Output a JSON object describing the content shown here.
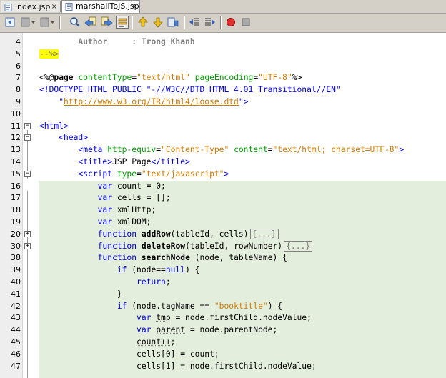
{
  "tabs": [
    {
      "label": "index.jsp",
      "close": "×",
      "active": false
    },
    {
      "label": "marshallToJS.jsp",
      "close": "×",
      "active": true
    }
  ],
  "toolbar": {
    "buttons": [
      "back-icon",
      "forward-dropdown-icon",
      "history-dropdown-icon",
      "find-icon",
      "find-previous-icon",
      "find-next-icon",
      "toggle-highlight-icon",
      "previous-bookmark-icon",
      "next-bookmark-icon",
      "toggle-bookmark-icon",
      "shift-left-icon",
      "shift-right-icon",
      "start-macro-icon",
      "stop-macro-icon"
    ]
  },
  "editor": {
    "lines": [
      {
        "n": "4",
        "segs": [
          {
            "t": "        Author     : Trong Khanh",
            "c": "cmt-bold"
          }
        ]
      },
      {
        "n": "5",
        "segs": [
          {
            "t": "--%>",
            "c": "yel"
          }
        ]
      },
      {
        "n": "6",
        "segs": [
          {
            "t": "",
            "c": "black"
          }
        ]
      },
      {
        "n": "7",
        "segs": [
          {
            "t": "<%@",
            "c": "black"
          },
          {
            "t": "page",
            "c": "bold"
          },
          {
            "t": " ",
            "c": "black"
          },
          {
            "t": "contentType",
            "c": "attr"
          },
          {
            "t": "=",
            "c": "black"
          },
          {
            "t": "\"text/html\"",
            "c": "str"
          },
          {
            "t": " ",
            "c": "black"
          },
          {
            "t": "pageEncoding",
            "c": "attr"
          },
          {
            "t": "=",
            "c": "black"
          },
          {
            "t": "\"UTF-8\"",
            "c": "str"
          },
          {
            "t": "%>",
            "c": "black"
          }
        ]
      },
      {
        "n": "8",
        "segs": [
          {
            "t": "<!DOCTYPE HTML PUBLIC \"-//W3C//DTD HTML 4.01 Transitional//EN\"",
            "c": "tag"
          }
        ]
      },
      {
        "n": "9",
        "segs": [
          {
            "t": "    \"",
            "c": "tag"
          },
          {
            "t": "http://www.w3.org/TR/html4/loose.dtd",
            "c": "url"
          },
          {
            "t": "\">",
            "c": "tag"
          }
        ]
      },
      {
        "n": "10",
        "segs": [
          {
            "t": "",
            "c": "black"
          }
        ]
      },
      {
        "n": "11",
        "segs": [
          {
            "t": "<html>",
            "c": "tag"
          }
        ]
      },
      {
        "n": "12",
        "segs": [
          {
            "t": "    <head>",
            "c": "tag"
          }
        ]
      },
      {
        "n": "13",
        "segs": [
          {
            "t": "        <meta ",
            "c": "tag"
          },
          {
            "t": "http-equiv",
            "c": "attr"
          },
          {
            "t": "=",
            "c": "black"
          },
          {
            "t": "\"Content-Type\"",
            "c": "str"
          },
          {
            "t": " ",
            "c": "black"
          },
          {
            "t": "content",
            "c": "attr"
          },
          {
            "t": "=",
            "c": "black"
          },
          {
            "t": "\"text/html; charset=UTF-8\"",
            "c": "str"
          },
          {
            "t": ">",
            "c": "tag"
          }
        ]
      },
      {
        "n": "14",
        "segs": [
          {
            "t": "        <title>",
            "c": "tag"
          },
          {
            "t": "JSP Page",
            "c": "black"
          },
          {
            "t": "</title>",
            "c": "tag"
          }
        ]
      },
      {
        "n": "15",
        "segs": [
          {
            "t": "        <script ",
            "c": "tag"
          },
          {
            "t": "type",
            "c": "attr"
          },
          {
            "t": "=",
            "c": "black"
          },
          {
            "t": "\"text/javascript\"",
            "c": "str"
          },
          {
            "t": ">",
            "c": "tag"
          }
        ]
      },
      {
        "n": "16",
        "segs": [
          {
            "t": "            ",
            "c": "black"
          },
          {
            "t": "var",
            "c": "kw"
          },
          {
            "t": " count = 0;",
            "c": "black"
          }
        ]
      },
      {
        "n": "17",
        "segs": [
          {
            "t": "            ",
            "c": "black"
          },
          {
            "t": "var",
            "c": "kw"
          },
          {
            "t": " cells = [];",
            "c": "black"
          }
        ]
      },
      {
        "n": "18",
        "segs": [
          {
            "t": "            ",
            "c": "black"
          },
          {
            "t": "var",
            "c": "kw"
          },
          {
            "t": " xmlHttp;",
            "c": "black"
          }
        ]
      },
      {
        "n": "19",
        "segs": [
          {
            "t": "            ",
            "c": "black"
          },
          {
            "t": "var",
            "c": "kw"
          },
          {
            "t": " xmlDOM;",
            "c": "black"
          }
        ]
      },
      {
        "n": "20",
        "segs": [
          {
            "t": "            ",
            "c": "black"
          },
          {
            "t": "function",
            "c": "kw"
          },
          {
            "t": " ",
            "c": "black"
          },
          {
            "t": "addRow",
            "c": "bold"
          },
          {
            "t": "(tableId, cells)",
            "c": "black"
          },
          {
            "t": "{...}",
            "c": "collapsed"
          }
        ]
      },
      {
        "n": "30",
        "segs": [
          {
            "t": "            ",
            "c": "black"
          },
          {
            "t": "function",
            "c": "kw"
          },
          {
            "t": " ",
            "c": "black"
          },
          {
            "t": "deleteRow",
            "c": "bold"
          },
          {
            "t": "(tableId, rowNumber)",
            "c": "black"
          },
          {
            "t": "{...}",
            "c": "collapsed"
          }
        ]
      },
      {
        "n": "38",
        "segs": [
          {
            "t": "            ",
            "c": "black"
          },
          {
            "t": "function",
            "c": "kw"
          },
          {
            "t": " ",
            "c": "black"
          },
          {
            "t": "searchNode",
            "c": "bold"
          },
          {
            "t": " (node, tableName) {",
            "c": "black"
          }
        ]
      },
      {
        "n": "39",
        "segs": [
          {
            "t": "                ",
            "c": "black"
          },
          {
            "t": "if",
            "c": "kw"
          },
          {
            "t": " (node==",
            "c": "black"
          },
          {
            "t": "null",
            "c": "kw"
          },
          {
            "t": ") {",
            "c": "black"
          }
        ]
      },
      {
        "n": "40",
        "segs": [
          {
            "t": "                    ",
            "c": "black"
          },
          {
            "t": "return",
            "c": "kw"
          },
          {
            "t": ";",
            "c": "black"
          }
        ]
      },
      {
        "n": "41",
        "segs": [
          {
            "t": "                }",
            "c": "black"
          }
        ]
      },
      {
        "n": "42",
        "segs": [
          {
            "t": "                ",
            "c": "black"
          },
          {
            "t": "if",
            "c": "kw"
          },
          {
            "t": " (node.tagName == ",
            "c": "black"
          },
          {
            "t": "\"booktitle\"",
            "c": "str"
          },
          {
            "t": ") {",
            "c": "black"
          }
        ]
      },
      {
        "n": "43",
        "segs": [
          {
            "t": "                    ",
            "c": "black"
          },
          {
            "t": "var",
            "c": "kw"
          },
          {
            "t": " ",
            "c": "black"
          },
          {
            "t": "tmp",
            "c": "err"
          },
          {
            "t": " = node.firstChild.nodeValue;",
            "c": "black"
          }
        ]
      },
      {
        "n": "44",
        "segs": [
          {
            "t": "                    ",
            "c": "black"
          },
          {
            "t": "var",
            "c": "kw"
          },
          {
            "t": " ",
            "c": "black"
          },
          {
            "t": "parent",
            "c": "err"
          },
          {
            "t": " = node.parentNode;",
            "c": "black"
          }
        ]
      },
      {
        "n": "45",
        "segs": [
          {
            "t": "                    ",
            "c": "black"
          },
          {
            "t": "count++",
            "c": "err"
          },
          {
            "t": ";",
            "c": "black"
          }
        ]
      },
      {
        "n": "46",
        "segs": [
          {
            "t": "                    cells[0] = count;",
            "c": "black"
          }
        ]
      },
      {
        "n": "47",
        "segs": [
          {
            "t": "                    cells[1] = node.firstChild.nodeValue;",
            "c": "black"
          }
        ]
      }
    ]
  }
}
